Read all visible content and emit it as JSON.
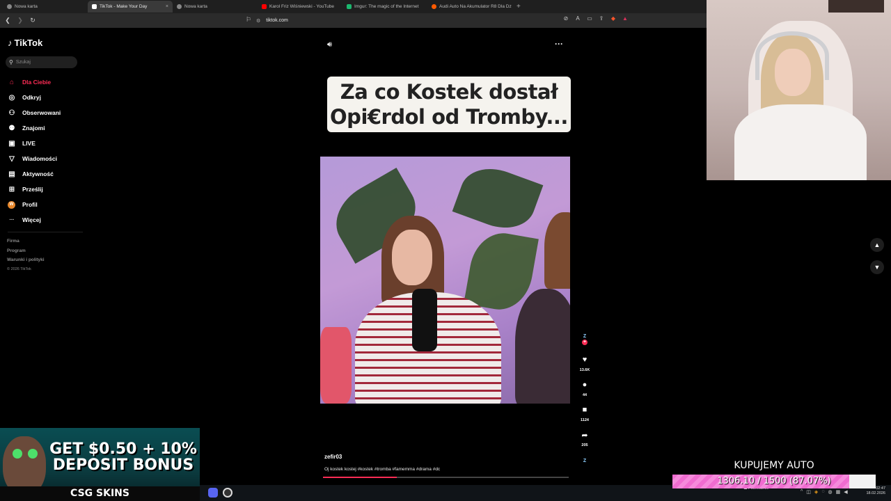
{
  "browser": {
    "tabs": [
      {
        "label": "Nowa karta",
        "icon": "shield-icon",
        "color": "#aaaaaa"
      },
      {
        "label": "TikTok - Make Your Day",
        "icon": "tiktok-icon",
        "color": "#ffffff",
        "active": true
      },
      {
        "label": "Nowa karta",
        "icon": "shield-icon",
        "color": "#aaaaaa"
      },
      {
        "label": "Karol Friz Wiśniewski - YouTube",
        "icon": "youtube-icon",
        "color": "#ff0000"
      },
      {
        "label": "Imgur: The magic of the Internet",
        "icon": "imgur-icon",
        "color": "#1bb76e"
      },
      {
        "label": "Audi Auto Na Akumulator R8 Dla Dz",
        "icon": "allegro-icon",
        "color": "#ff5a00"
      }
    ],
    "close_glyph": "×",
    "new_tab_glyph": "+",
    "url": "tiktok.com"
  },
  "sidebar": {
    "logo": "TikTok",
    "search_placeholder": "Szukaj",
    "items": [
      {
        "label": "Dla Ciebie",
        "icon": "home-icon",
        "glyph": "⌂",
        "active": true
      },
      {
        "label": "Odkryj",
        "icon": "compass-icon",
        "glyph": "◎"
      },
      {
        "label": "Obserwowani",
        "icon": "following-icon",
        "glyph": "⚇"
      },
      {
        "label": "Znajomi",
        "icon": "friends-icon",
        "glyph": "⚉"
      },
      {
        "label": "LIVE",
        "icon": "live-icon",
        "glyph": "▣"
      },
      {
        "label": "Wiadomości",
        "icon": "messages-icon",
        "glyph": "▽"
      },
      {
        "label": "Aktywność",
        "icon": "activity-icon",
        "glyph": "▤"
      },
      {
        "label": "Prześlij",
        "icon": "upload-icon",
        "glyph": "⊞"
      },
      {
        "label": "Profil",
        "icon": "profile-icon",
        "glyph": "W"
      },
      {
        "label": "Więcej",
        "icon": "more-icon",
        "glyph": "···"
      }
    ],
    "footer": [
      "Firma",
      "Program",
      "Warunki i polityki"
    ],
    "copyright": "© 2026 TikTok"
  },
  "video": {
    "caption_line1": "Za co Kostek dostał",
    "caption_line2": "Opi€rdol od Tromby...",
    "username": "zefir03",
    "description": "Oj kostek kostej #kostek #tromba #famemma #drama #dc",
    "progress": 0.3,
    "likes": "13.6K",
    "comments": "44",
    "saves": "1124",
    "shares": "205",
    "creator_badge": "Z"
  },
  "ad": {
    "headline": "GET $0.50 + 10% DEPOSIT BONUS",
    "brand": "CSG SKINS"
  },
  "goal": {
    "title": "KUPUJEMY AUTO",
    "text": "1306.10 / 1500 (87.07%)",
    "fraction": 0.8707,
    "fill_color": "#f06cd0"
  },
  "taskbar": {
    "weather": "Pochmurnie",
    "time": "02:47",
    "date": "18.02.2026"
  }
}
